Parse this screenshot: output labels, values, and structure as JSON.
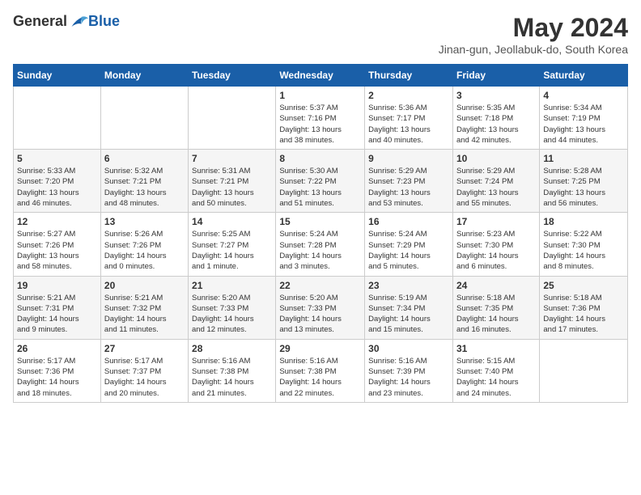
{
  "header": {
    "logo_general": "General",
    "logo_blue": "Blue",
    "month_year": "May 2024",
    "location": "Jinan-gun, Jeollabuk-do, South Korea"
  },
  "weekdays": [
    "Sunday",
    "Monday",
    "Tuesday",
    "Wednesday",
    "Thursday",
    "Friday",
    "Saturday"
  ],
  "weeks": [
    [
      {
        "day": "",
        "info": ""
      },
      {
        "day": "",
        "info": ""
      },
      {
        "day": "",
        "info": ""
      },
      {
        "day": "1",
        "info": "Sunrise: 5:37 AM\nSunset: 7:16 PM\nDaylight: 13 hours\nand 38 minutes."
      },
      {
        "day": "2",
        "info": "Sunrise: 5:36 AM\nSunset: 7:17 PM\nDaylight: 13 hours\nand 40 minutes."
      },
      {
        "day": "3",
        "info": "Sunrise: 5:35 AM\nSunset: 7:18 PM\nDaylight: 13 hours\nand 42 minutes."
      },
      {
        "day": "4",
        "info": "Sunrise: 5:34 AM\nSunset: 7:19 PM\nDaylight: 13 hours\nand 44 minutes."
      }
    ],
    [
      {
        "day": "5",
        "info": "Sunrise: 5:33 AM\nSunset: 7:20 PM\nDaylight: 13 hours\nand 46 minutes."
      },
      {
        "day": "6",
        "info": "Sunrise: 5:32 AM\nSunset: 7:21 PM\nDaylight: 13 hours\nand 48 minutes."
      },
      {
        "day": "7",
        "info": "Sunrise: 5:31 AM\nSunset: 7:21 PM\nDaylight: 13 hours\nand 50 minutes."
      },
      {
        "day": "8",
        "info": "Sunrise: 5:30 AM\nSunset: 7:22 PM\nDaylight: 13 hours\nand 51 minutes."
      },
      {
        "day": "9",
        "info": "Sunrise: 5:29 AM\nSunset: 7:23 PM\nDaylight: 13 hours\nand 53 minutes."
      },
      {
        "day": "10",
        "info": "Sunrise: 5:29 AM\nSunset: 7:24 PM\nDaylight: 13 hours\nand 55 minutes."
      },
      {
        "day": "11",
        "info": "Sunrise: 5:28 AM\nSunset: 7:25 PM\nDaylight: 13 hours\nand 56 minutes."
      }
    ],
    [
      {
        "day": "12",
        "info": "Sunrise: 5:27 AM\nSunset: 7:26 PM\nDaylight: 13 hours\nand 58 minutes."
      },
      {
        "day": "13",
        "info": "Sunrise: 5:26 AM\nSunset: 7:26 PM\nDaylight: 14 hours\nand 0 minutes."
      },
      {
        "day": "14",
        "info": "Sunrise: 5:25 AM\nSunset: 7:27 PM\nDaylight: 14 hours\nand 1 minute."
      },
      {
        "day": "15",
        "info": "Sunrise: 5:24 AM\nSunset: 7:28 PM\nDaylight: 14 hours\nand 3 minutes."
      },
      {
        "day": "16",
        "info": "Sunrise: 5:24 AM\nSunset: 7:29 PM\nDaylight: 14 hours\nand 5 minutes."
      },
      {
        "day": "17",
        "info": "Sunrise: 5:23 AM\nSunset: 7:30 PM\nDaylight: 14 hours\nand 6 minutes."
      },
      {
        "day": "18",
        "info": "Sunrise: 5:22 AM\nSunset: 7:30 PM\nDaylight: 14 hours\nand 8 minutes."
      }
    ],
    [
      {
        "day": "19",
        "info": "Sunrise: 5:21 AM\nSunset: 7:31 PM\nDaylight: 14 hours\nand 9 minutes."
      },
      {
        "day": "20",
        "info": "Sunrise: 5:21 AM\nSunset: 7:32 PM\nDaylight: 14 hours\nand 11 minutes."
      },
      {
        "day": "21",
        "info": "Sunrise: 5:20 AM\nSunset: 7:33 PM\nDaylight: 14 hours\nand 12 minutes."
      },
      {
        "day": "22",
        "info": "Sunrise: 5:20 AM\nSunset: 7:33 PM\nDaylight: 14 hours\nand 13 minutes."
      },
      {
        "day": "23",
        "info": "Sunrise: 5:19 AM\nSunset: 7:34 PM\nDaylight: 14 hours\nand 15 minutes."
      },
      {
        "day": "24",
        "info": "Sunrise: 5:18 AM\nSunset: 7:35 PM\nDaylight: 14 hours\nand 16 minutes."
      },
      {
        "day": "25",
        "info": "Sunrise: 5:18 AM\nSunset: 7:36 PM\nDaylight: 14 hours\nand 17 minutes."
      }
    ],
    [
      {
        "day": "26",
        "info": "Sunrise: 5:17 AM\nSunset: 7:36 PM\nDaylight: 14 hours\nand 18 minutes."
      },
      {
        "day": "27",
        "info": "Sunrise: 5:17 AM\nSunset: 7:37 PM\nDaylight: 14 hours\nand 20 minutes."
      },
      {
        "day": "28",
        "info": "Sunrise: 5:16 AM\nSunset: 7:38 PM\nDaylight: 14 hours\nand 21 minutes."
      },
      {
        "day": "29",
        "info": "Sunrise: 5:16 AM\nSunset: 7:38 PM\nDaylight: 14 hours\nand 22 minutes."
      },
      {
        "day": "30",
        "info": "Sunrise: 5:16 AM\nSunset: 7:39 PM\nDaylight: 14 hours\nand 23 minutes."
      },
      {
        "day": "31",
        "info": "Sunrise: 5:15 AM\nSunset: 7:40 PM\nDaylight: 14 hours\nand 24 minutes."
      },
      {
        "day": "",
        "info": ""
      }
    ]
  ]
}
